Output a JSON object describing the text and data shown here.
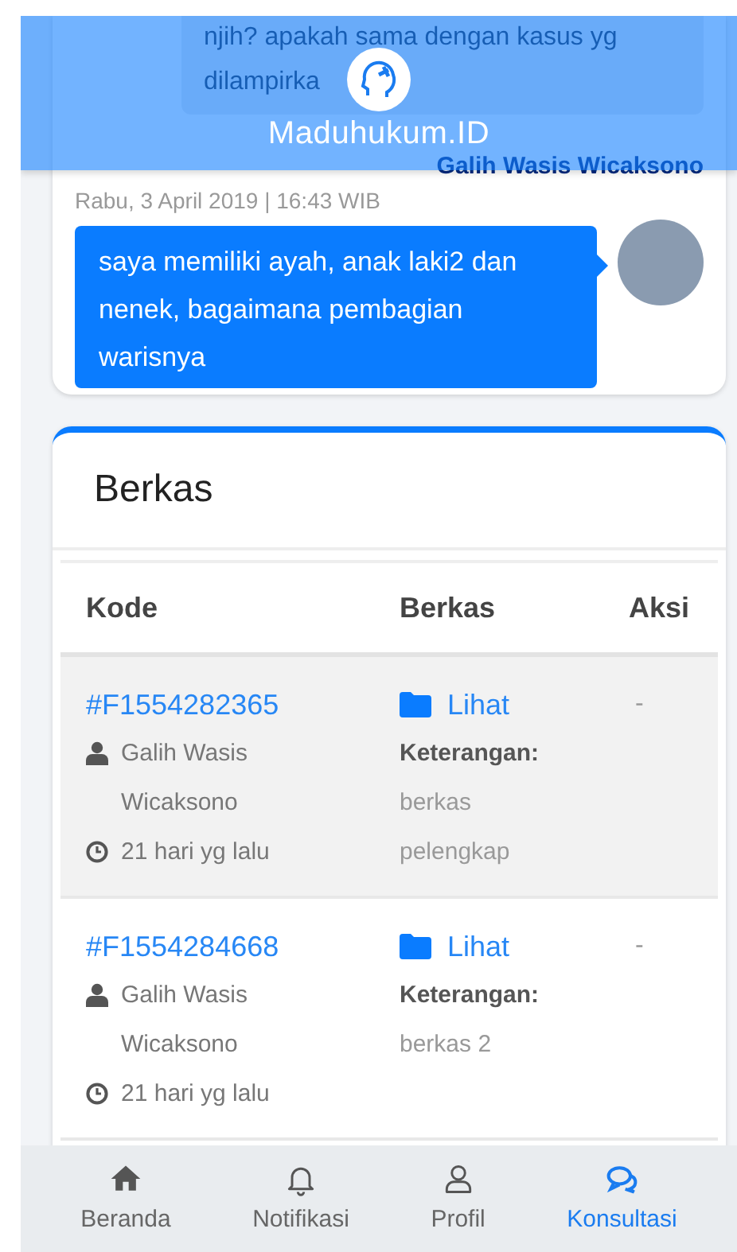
{
  "header": {
    "title": "Maduhukum.ID"
  },
  "chat": {
    "previous_message": {
      "lines": [
        "njih? apakah sama dengan kasus yg",
        "dilampirka"
      ],
      "author": "Galih Wasis Wicaksono"
    },
    "message": {
      "time": "Rabu, 3 April 2019 | 16:43 WIB",
      "text": "saya memiliki ayah, anak laki2 dan nenek, bagaimana pembagian warisnya"
    }
  },
  "files": {
    "title": "Berkas",
    "columns": [
      "Kode",
      "Berkas",
      "Aksi"
    ],
    "rows": [
      {
        "code": "#F1554282365",
        "user": "Galih Wasis Wicaksono",
        "time": "21 hari yg lalu",
        "link": "Lihat",
        "note_label": "Keterangan:",
        "note": "berkas pelengkap",
        "action": "-"
      },
      {
        "code": "#F1554284668",
        "user": "Galih Wasis Wicaksono",
        "time": "21 hari yg lalu",
        "link": "Lihat",
        "note_label": "Keterangan:",
        "note": "berkas 2",
        "action": "-"
      }
    ]
  },
  "nav": [
    {
      "label": "Beranda",
      "kind": "home",
      "selected": false
    },
    {
      "label": "Notifikasi",
      "kind": "bell",
      "selected": false
    },
    {
      "label": "Profil",
      "kind": "user",
      "selected": false
    },
    {
      "label": "Konsultasi",
      "kind": "chat",
      "selected": true
    }
  ]
}
